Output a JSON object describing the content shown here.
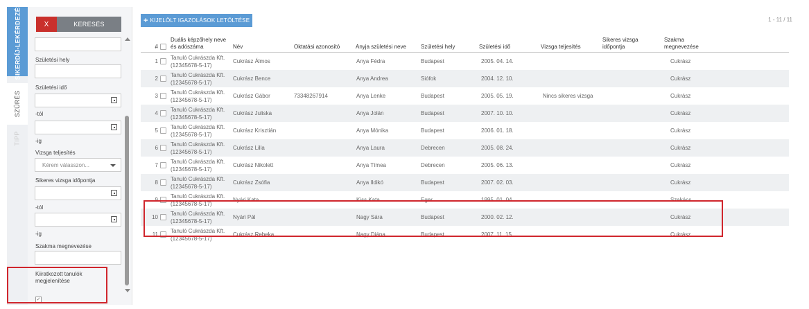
{
  "tabs": {
    "lekerdezes": "SIKERDÍJ-LEKÉRDEZÉS",
    "szures": "SZŰRÉS",
    "tipp": "TIPP"
  },
  "filter": {
    "clear_label": "X",
    "search_label": "KERESÉS",
    "szuletesi_hely": "Születési hely",
    "szuletesi_ido": "Születési idő",
    "tol": "-tól",
    "ig": "-ig",
    "vizsga_teljesites": "Vizsga teljesítés",
    "vizsga_placeholder": "Kérem válasszon...",
    "sikeres_vizsga": "Sikeres vizsga időpontja",
    "tol2": "-tól",
    "ig2": "-ig",
    "szakma": "Szakma megnevezése",
    "kiiratkozott": "Kiiratkozott tanulók megjelenítése",
    "kiiratkozott_checked": true
  },
  "main": {
    "download_label": "KIJELÖLT IGAZOLÁSOK LETÖLTÉSE",
    "pager": "1 - 11 / 11",
    "columns": {
      "num": "#",
      "kepzohely": "Duális képzőhely neve és adószáma",
      "nev": "Név",
      "oktatasi": "Oktatási azonosító",
      "anyja": "Anyja születési neve",
      "szul_hely": "Születési hely",
      "szul_ido": "Születési idő",
      "vizsga": "Vizsga teljesítés",
      "sikeres": "Sikeres vizsga időpontja",
      "szakma": "Szakma megnevezése"
    },
    "rows": [
      {
        "n": "1",
        "kepzohely": "Tanuló Cukrászda Kft.",
        "adoszam": "(12345678-5-17)",
        "nev": "Cukrász Álmos",
        "oktatasi": "",
        "anyja": "Anya Fédra",
        "hely": "Budapest",
        "ido": "2005. 04. 14.",
        "vizsga": "",
        "sikeres": "",
        "szakma": "Cukrász"
      },
      {
        "n": "2",
        "kepzohely": "Tanuló Cukrászda Kft.",
        "adoszam": "(12345678-5-17)",
        "nev": "Cukrász Bence",
        "oktatasi": "",
        "anyja": "Anya Andrea",
        "hely": "Siófok",
        "ido": "2004. 12. 10.",
        "vizsga": "",
        "sikeres": "",
        "szakma": "Cukrász"
      },
      {
        "n": "3",
        "kepzohely": "Tanuló Cukrászda Kft.",
        "adoszam": "(12345678-5-17)",
        "nev": "Cukrász Gábor",
        "oktatasi": "73348267914",
        "anyja": "Anya Lenke",
        "hely": "Budapest",
        "ido": "2005. 05. 19.",
        "vizsga": "Nincs sikeres vizsga",
        "sikeres": "",
        "szakma": "Cukrász"
      },
      {
        "n": "4",
        "kepzohely": "Tanuló Cukrászda Kft.",
        "adoszam": "(12345678-5-17)",
        "nev": "Cukrász Juliska",
        "oktatasi": "",
        "anyja": "Anya Jolán",
        "hely": "Budapest",
        "ido": "2007. 10. 10.",
        "vizsga": "",
        "sikeres": "",
        "szakma": "Cukrász"
      },
      {
        "n": "5",
        "kepzohely": "Tanuló Cukrászda Kft.",
        "adoszam": "(12345678-5-17)",
        "nev": "Cukrász Krisztián",
        "oktatasi": "",
        "anyja": "Anya Mónika",
        "hely": "Budapest",
        "ido": "2006. 01. 18.",
        "vizsga": "",
        "sikeres": "",
        "szakma": "Cukrász"
      },
      {
        "n": "6",
        "kepzohely": "Tanuló Cukrászda Kft.",
        "adoszam": "(12345678-5-17)",
        "nev": "Cukrász Lilla",
        "oktatasi": "",
        "anyja": "Anya Laura",
        "hely": "Debrecen",
        "ido": "2005. 08. 24.",
        "vizsga": "",
        "sikeres": "",
        "szakma": "Cukrász"
      },
      {
        "n": "7",
        "kepzohely": "Tanuló Cukrászda Kft.",
        "adoszam": "(12345678-5-17)",
        "nev": "Cukrász Nikolett",
        "oktatasi": "",
        "anyja": "Anya Tímea",
        "hely": "Debrecen",
        "ido": "2005. 06. 13.",
        "vizsga": "",
        "sikeres": "",
        "szakma": "Cukrász"
      },
      {
        "n": "8",
        "kepzohely": "Tanuló Cukrászda Kft.",
        "adoszam": "(12345678-5-17)",
        "nev": "Cukrász Zsófia",
        "oktatasi": "",
        "anyja": "Anya Ildikó",
        "hely": "Budapest",
        "ido": "2007. 02. 03.",
        "vizsga": "",
        "sikeres": "",
        "szakma": "Cukrász"
      },
      {
        "n": "9",
        "kepzohely": "Tanuló Cukrászda Kft.",
        "adoszam": "(12345678-5-17)",
        "nev": "Nyári Kata",
        "oktatasi": "",
        "anyja": "Kiss Kata",
        "hely": "Eger",
        "ido": "1995. 01. 04.",
        "vizsga": "",
        "sikeres": "",
        "szakma": "Szakács"
      },
      {
        "n": "10",
        "kepzohely": "Tanuló Cukrászda Kft.",
        "adoszam": "(12345678-5-17)",
        "nev": "Nyári Pál",
        "oktatasi": "",
        "anyja": "Nagy Sára",
        "hely": "Budapest",
        "ido": "2000. 02. 12.",
        "vizsga": "",
        "sikeres": "",
        "szakma": "Cukrász"
      },
      {
        "n": "11",
        "kepzohely": "Tanuló Cukrászda Kft.",
        "adoszam": "(12345678-5-17)",
        "nev": "Cukrász Rebeka",
        "oktatasi": "",
        "anyja": "Nagy Diána",
        "hely": "Budapest",
        "ido": "2007. 11. 15.",
        "vizsga": "",
        "sikeres": "",
        "szakma": "Cukrász"
      }
    ]
  },
  "icons": {
    "calendar": "calendar-icon",
    "plus": "plus-icon",
    "caret": "chevron-down-icon"
  },
  "colors": {
    "accent": "#5b9bd5",
    "danger": "#c9302c",
    "highlight": "#d0262d"
  }
}
